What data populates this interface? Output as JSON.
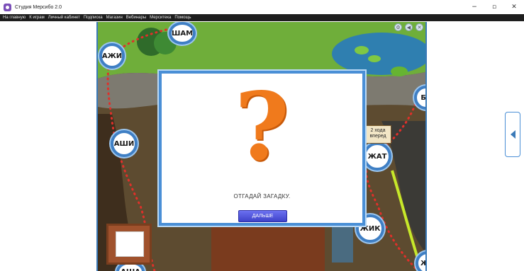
{
  "window": {
    "title": "Студия Мерсибо 2.0",
    "minimize_glyph": "−",
    "maximize_glyph": "▫",
    "close_glyph": "✕"
  },
  "menu": {
    "items": [
      "На главную",
      "К играм",
      "Личный кабинет",
      "Подписка",
      "Магазин",
      "Вебинары",
      "Мерситека",
      "Помощь"
    ]
  },
  "board": {
    "nodes": [
      "ШАМ",
      "АЖИ",
      "АШИ",
      "ЖАТ",
      "ЖИК",
      "БА",
      "ЖУ",
      "АША"
    ],
    "sign_text": "2 хода вперед",
    "colors": {
      "path_dots": "#e0302a",
      "node_ring": "#3f7fc4",
      "grass": "#6fae3a",
      "water": "#2f7fb0"
    }
  },
  "modal": {
    "symbol": "?",
    "prompt": "ОТГАДАЙ ЗАГАДКУ.",
    "next_button": "ДАЛЬШЕ",
    "accent_color": "#f07a1c",
    "button_color": "#4a4ed8"
  },
  "side_panel": {
    "icon": "chevron-left-icon"
  }
}
